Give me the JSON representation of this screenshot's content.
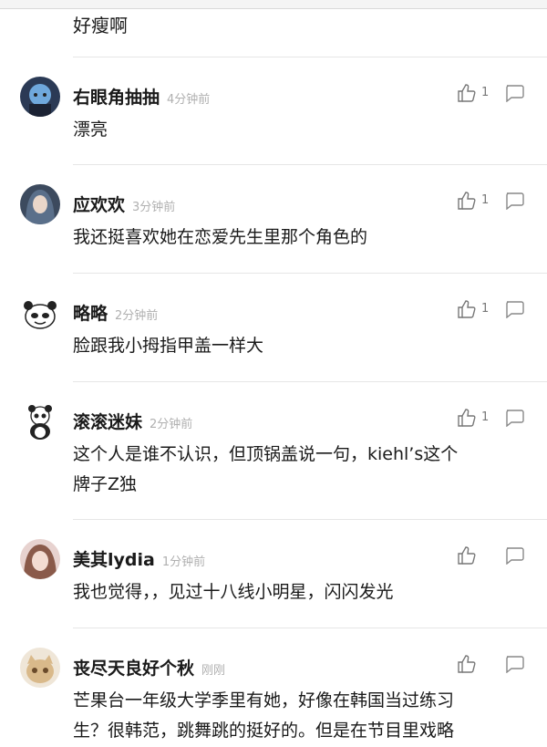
{
  "first_comment": {
    "text": "好瘦啊"
  },
  "comments": [
    {
      "user": "右眼角抽抽",
      "time": "4分钟前",
      "text": [
        "漂亮"
      ],
      "likes": "1",
      "avatar": "anime-avatar"
    },
    {
      "user": "应欢欢",
      "time": "3分钟前",
      "text": [
        "我还挺喜欢她在恋爱先生里那个角色的"
      ],
      "likes": "1",
      "avatar": "illustrated-girl-avatar"
    },
    {
      "user": "略略",
      "time": "2分钟前",
      "text": [
        "脸跟我小拇指甲盖一样大"
      ],
      "likes": "1",
      "avatar": "panda-meme-avatar"
    },
    {
      "user": "滚滚迷妹",
      "time": "2分钟前",
      "text": [
        "这个人是谁不认识，但顶锅盖说一句，kiehl’s这个",
        "牌子Z独"
      ],
      "likes": "1",
      "avatar": "panda-avatar"
    },
    {
      "user": "美其lydia",
      "time": "1分钟前",
      "text": [
        "我也觉得，，见过十八线小明星，闪闪发光"
      ],
      "likes": "",
      "avatar": "girl-photo-avatar"
    },
    {
      "user": "丧尽天良好个秋",
      "time": "刚刚",
      "text": [
        "芒果台一年级大学季里有她，好像在韩国当过练习",
        "生？很韩范，跳舞跳的挺好的。但是在节目里戏略"
      ],
      "likes": "",
      "avatar": "cat-avatar"
    }
  ],
  "icons": {
    "like": "thumbs-up-icon",
    "reply": "speech-bubble-icon"
  }
}
